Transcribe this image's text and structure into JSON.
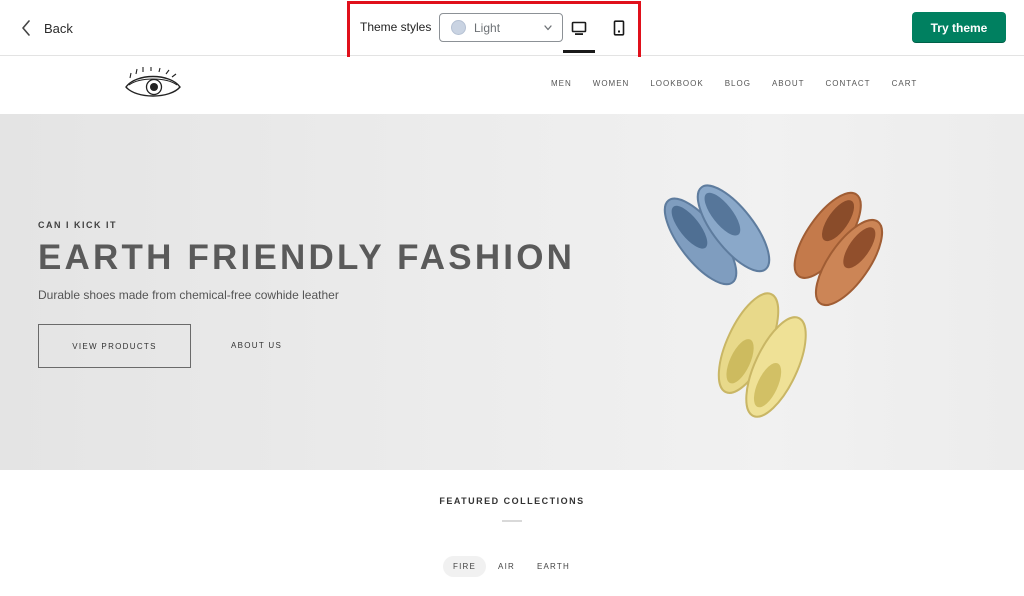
{
  "editor": {
    "back_label": "Back",
    "theme_styles_label": "Theme styles",
    "style_select": {
      "value": "Light",
      "swatch_color": "#c9d3e2"
    },
    "preview_devices": [
      "desktop",
      "mobile"
    ],
    "active_device": "desktop",
    "try_button_label": "Try theme",
    "try_button_color": "#008060",
    "highlight_color": "#e0101b"
  },
  "store": {
    "logo_icon": "eye-logo",
    "nav": [
      "MEN",
      "WOMEN",
      "LOOKBOOK",
      "BLOG",
      "ABOUT",
      "CONTACT",
      "CART"
    ],
    "hero": {
      "kicker": "CAN I KICK IT",
      "headline": "EARTH FRIENDLY FASHION",
      "subline": "Durable shoes made from chemical-free cowhide leather",
      "primary_button": "VIEW PRODUCTS",
      "secondary_button": "ABOUT US",
      "image": "shoes-flatlay"
    },
    "featured": {
      "title": "FEATURED COLLECTIONS",
      "tabs": [
        "FIRE",
        "AIR",
        "EARTH"
      ],
      "active_tab": "FIRE"
    }
  }
}
